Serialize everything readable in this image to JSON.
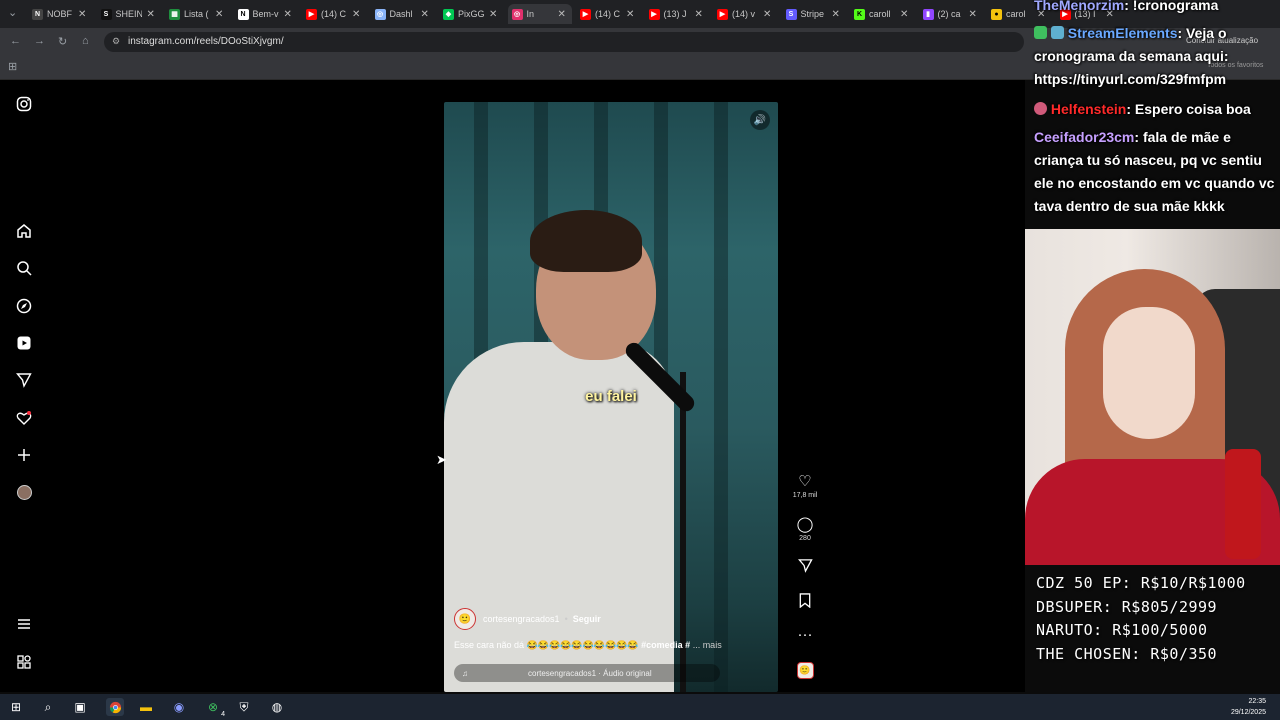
{
  "browser": {
    "tabs": [
      {
        "label": "NOBF",
        "icon": "nobf-favicon",
        "color": "#444444",
        "glyph": "N"
      },
      {
        "label": "SHEIN",
        "icon": "shein-favicon",
        "color": "#111111",
        "glyph": "S"
      },
      {
        "label": "Lista (",
        "icon": "sheets-favicon",
        "color": "#1e8e3e",
        "glyph": "▦"
      },
      {
        "label": "Bem-v",
        "icon": "notion-favicon",
        "color": "#ffffff",
        "glyph": "N"
      },
      {
        "label": "(14) C",
        "icon": "youtube-favicon",
        "color": "#ff0000",
        "glyph": "▶"
      },
      {
        "label": "Dashl",
        "icon": "dashboard-favicon",
        "color": "#8ab4f8",
        "glyph": "◎"
      },
      {
        "label": "PixGG",
        "icon": "pixgg-favicon",
        "color": "#00c853",
        "glyph": "◆"
      },
      {
        "label": "In",
        "icon": "instagram-favicon",
        "color": "#e1306c",
        "glyph": "◎",
        "active": true
      },
      {
        "label": "(14) C",
        "icon": "youtube-favicon",
        "color": "#ff0000",
        "glyph": "▶"
      },
      {
        "label": "(13) J",
        "icon": "youtube-favicon",
        "color": "#ff0000",
        "glyph": "▶"
      },
      {
        "label": "(14) v",
        "icon": "youtube-favicon",
        "color": "#ff0000",
        "glyph": "▶"
      },
      {
        "label": "Stripe",
        "icon": "stripe-favicon",
        "color": "#635bff",
        "glyph": "S"
      },
      {
        "label": "caroll",
        "icon": "kick-favicon",
        "color": "#53fc18",
        "glyph": "K"
      },
      {
        "label": "(2) ca",
        "icon": "twitch-favicon",
        "color": "#9146ff",
        "glyph": "▮"
      },
      {
        "label": "carol",
        "icon": "eye-favicon",
        "color": "#f4c20d",
        "glyph": "●"
      },
      {
        "label": "(13) I",
        "icon": "youtube-favicon",
        "color": "#ff0000",
        "glyph": "▶"
      }
    ],
    "url": "instagram.com/reels/DOoStiXjvgm/",
    "finish_update": "Concluir atualização",
    "all_bookmarks": "Todos os favoritos"
  },
  "instagram": {
    "sidebar_icons": [
      "instagram-logo-icon",
      "home-icon",
      "search-icon",
      "explore-icon",
      "reels-icon",
      "messages-icon",
      "notifications-icon",
      "create-icon",
      "profile-icon",
      "more-menu-icon",
      "also-from-meta-icon"
    ],
    "reel": {
      "subtitle": "eu falei",
      "username": "cortesengracados1",
      "follow": "Seguir",
      "caption_prefix": "Esse cara não dá",
      "caption_emojis": "😂😂😂😂😂😂😂😂😂😂",
      "caption_hashtag": "#comedia #",
      "caption_more": "... mais",
      "audio": "cortesengracados1 · Áudio original"
    },
    "actions": {
      "likes": "17,8 mil",
      "comments": "280"
    }
  },
  "stream_overlay": {
    "chat": [
      {
        "user": "TheMenorzim",
        "user_color": "#a0a8ff",
        "text": ": !cronograma"
      },
      {
        "user": "StreamElements",
        "user_color": "#6aa8ff",
        "text": ": Veja o cronograma da semana aqui: https://tinyurl.com/329fmfpm"
      },
      {
        "user": "Helfenstein",
        "user_color": "#ff2a2a",
        "text": ": Espero coisa boa"
      },
      {
        "user": "Ceeifador23cm",
        "user_color": "#c6a0ff",
        "text": ": fala de mãe e criança tu só nasceu, pq vc sentiu ele no encostando em vc quando vc tava dentro de sua mãe kkkk"
      }
    ],
    "goals": [
      "CDZ 50 EP: R$10/R$1000",
      "DBSUPER: R$805/2999",
      "NARUTO: R$100/5000",
      "THE CHOSEN: R$0/350"
    ]
  },
  "taskbar": {
    "time": "22:35",
    "date": "29/12/2025",
    "xbox_badge": "4"
  }
}
